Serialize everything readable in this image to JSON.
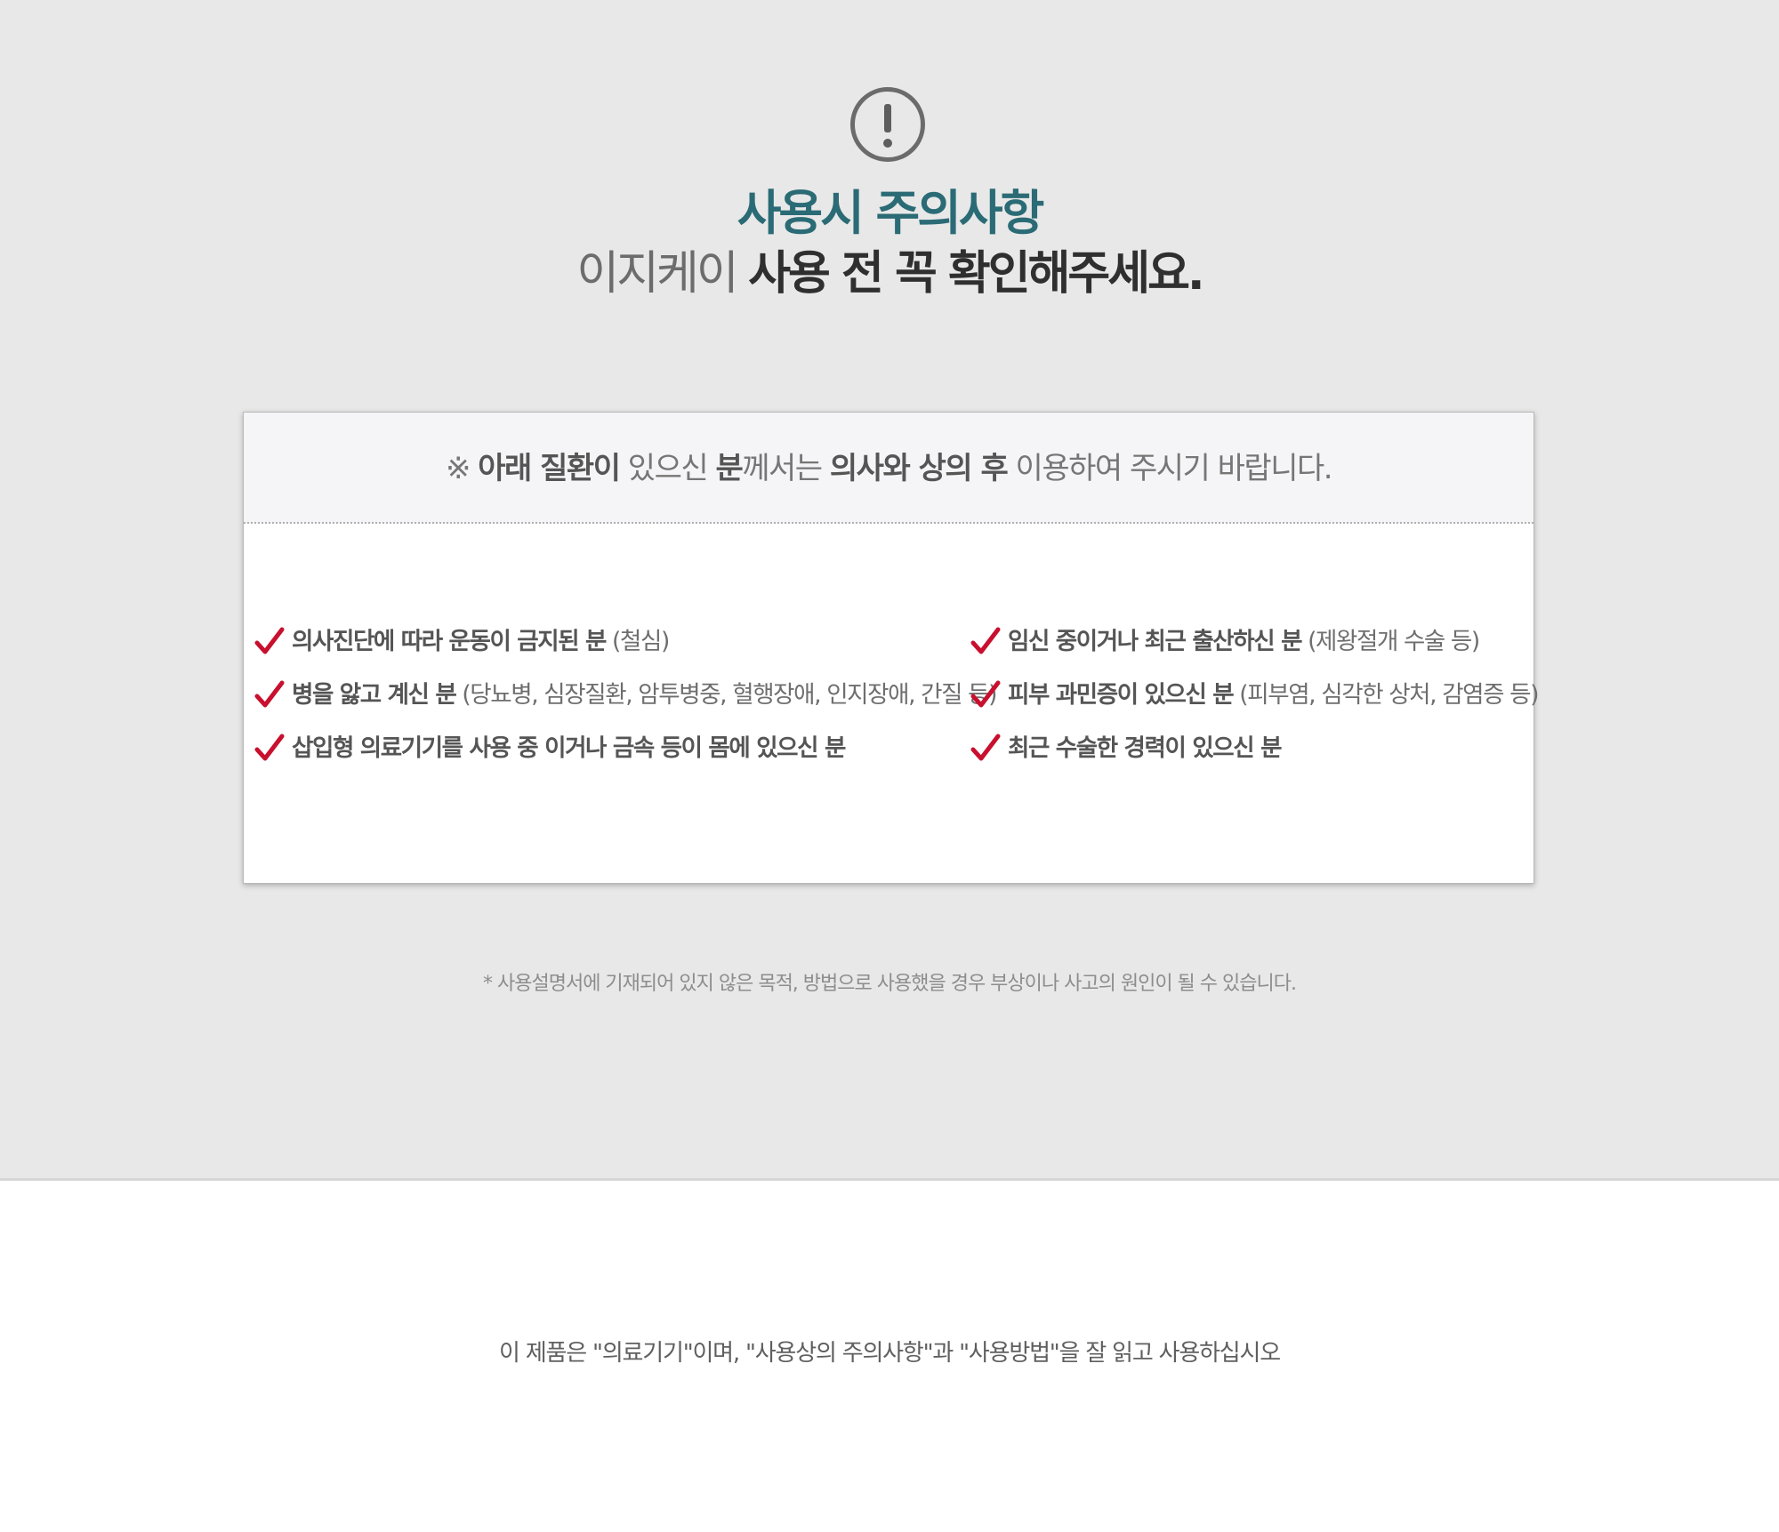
{
  "header": {
    "icon": "exclamation-circle-icon",
    "title": "사용시 주의사항",
    "subtitle_light": "이지케이",
    "subtitle_strong": "사용 전 꼭 확인해주세요."
  },
  "panel": {
    "notice": {
      "prefix": "※ ",
      "bold1": "아래 질환이",
      "text1": " 있으신 ",
      "bold2": "분",
      "text2": "께서는 ",
      "bold3": "의사와 상의 후",
      "text3": " 이용하여 주시기 바랍니다."
    },
    "check_color": "#c8102e",
    "items": [
      {
        "bold": "의사진단에 따라 운동이 금지된 분",
        "detail": " (철심)"
      },
      {
        "bold": "임신 중이거나 최근 출산하신 분",
        "detail": " (제왕절개 수술 등)"
      },
      {
        "bold": "병을 앓고 계신 분",
        "detail": " (당뇨병, 심장질환, 암투병중, 혈행장애, 인지장애, 간질 등)"
      },
      {
        "bold": "피부 과민증이 있으신 분",
        "detail": " (피부염, 심각한 상처, 감염증 등)"
      },
      {
        "bold": "삽입형 의료기기를 사용 중 이거나 금속 등이 몸에 있으신 분",
        "detail": ""
      },
      {
        "bold": "최근 수술한 경력이 있으신 분",
        "detail": ""
      }
    ]
  },
  "footnote": "* 사용설명서에 기재되어 있지 않은 목적, 방법으로 사용했을 경우 부상이나 사고의 원인이 될 수 있습니다.",
  "bottom_notice": "이 제품은 \"의료기기\"이며, \"사용상의 주의사항\"과 \"사용방법\"을 잘 읽고 사용하십시오"
}
